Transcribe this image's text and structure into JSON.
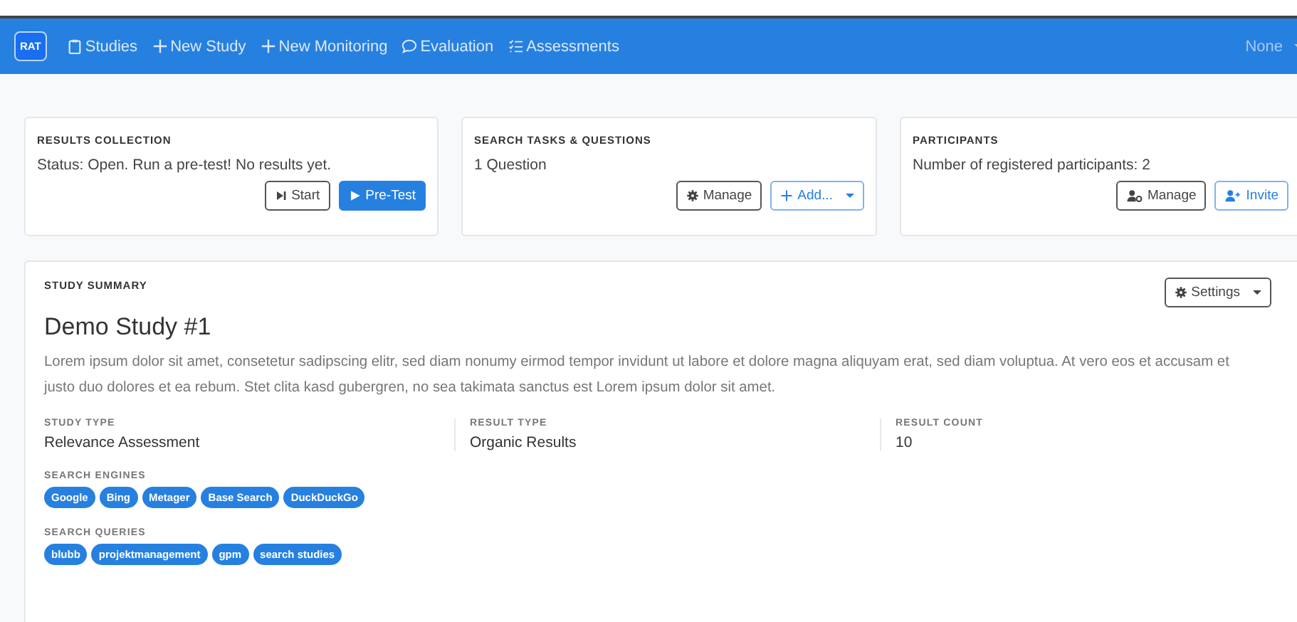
{
  "navbar": {
    "logo": "RAT",
    "items": [
      {
        "label": "Studies"
      },
      {
        "label": "New Study"
      },
      {
        "label": "New Monitoring"
      },
      {
        "label": "Evaluation"
      },
      {
        "label": "Assessments"
      }
    ],
    "user_menu": {
      "label": "None",
      "dropdown": true
    }
  },
  "cards": [
    {
      "title": "RESULTS COLLECTION",
      "text": "Status: Open. Run a pre-test! No results yet.",
      "buttons": [
        {
          "label": "Start",
          "kind": "outline-dark",
          "dropdown": false
        },
        {
          "label": "Pre-Test",
          "kind": "primary",
          "dropdown": false
        }
      ]
    },
    {
      "title": "SEARCH TASKS & QUESTIONS",
      "text": "1 Question",
      "buttons": [
        {
          "label": "Manage",
          "kind": "outline-dark",
          "dropdown": false
        },
        {
          "label": "Add...",
          "kind": "outline-primary",
          "dropdown": true
        }
      ]
    },
    {
      "title": "PARTICIPANTS",
      "text": "Number of registered participants: 2",
      "buttons": [
        {
          "label": "Manage",
          "kind": "outline-dark",
          "dropdown": false
        },
        {
          "label": "Invite",
          "kind": "outline-primary",
          "dropdown": false
        }
      ]
    }
  ],
  "summary": {
    "heading": "STUDY SUMMARY",
    "settings_button": {
      "label": "Settings",
      "dropdown": true
    },
    "title": "Demo Study #1",
    "description": "Lorem ipsum dolor sit amet, consetetur sadipscing elitr, sed diam nonumy eirmod tempor invidunt ut labore et dolore magna aliquyam erat, sed diam voluptua. At vero eos et accusam et justo duo dolores et ea rebum. Stet clita kasd gubergren, no sea takimata sanctus est Lorem ipsum dolor sit amet.",
    "facts": [
      {
        "label": "STUDY TYPE",
        "value": "Relevance Assessment"
      },
      {
        "label": "RESULT TYPE",
        "value": "Organic Results"
      },
      {
        "label": "RESULT COUNT",
        "value": "10"
      }
    ],
    "tag_groups": [
      {
        "label": "SEARCH ENGINES",
        "tags": [
          "Google",
          "Bing",
          "Metager",
          "Base Search",
          "DuckDuckGo"
        ]
      },
      {
        "label": "SEARCH QUERIES",
        "tags": [
          "blubb",
          "projektmanagement",
          "gpm",
          "search studies"
        ]
      }
    ]
  }
}
